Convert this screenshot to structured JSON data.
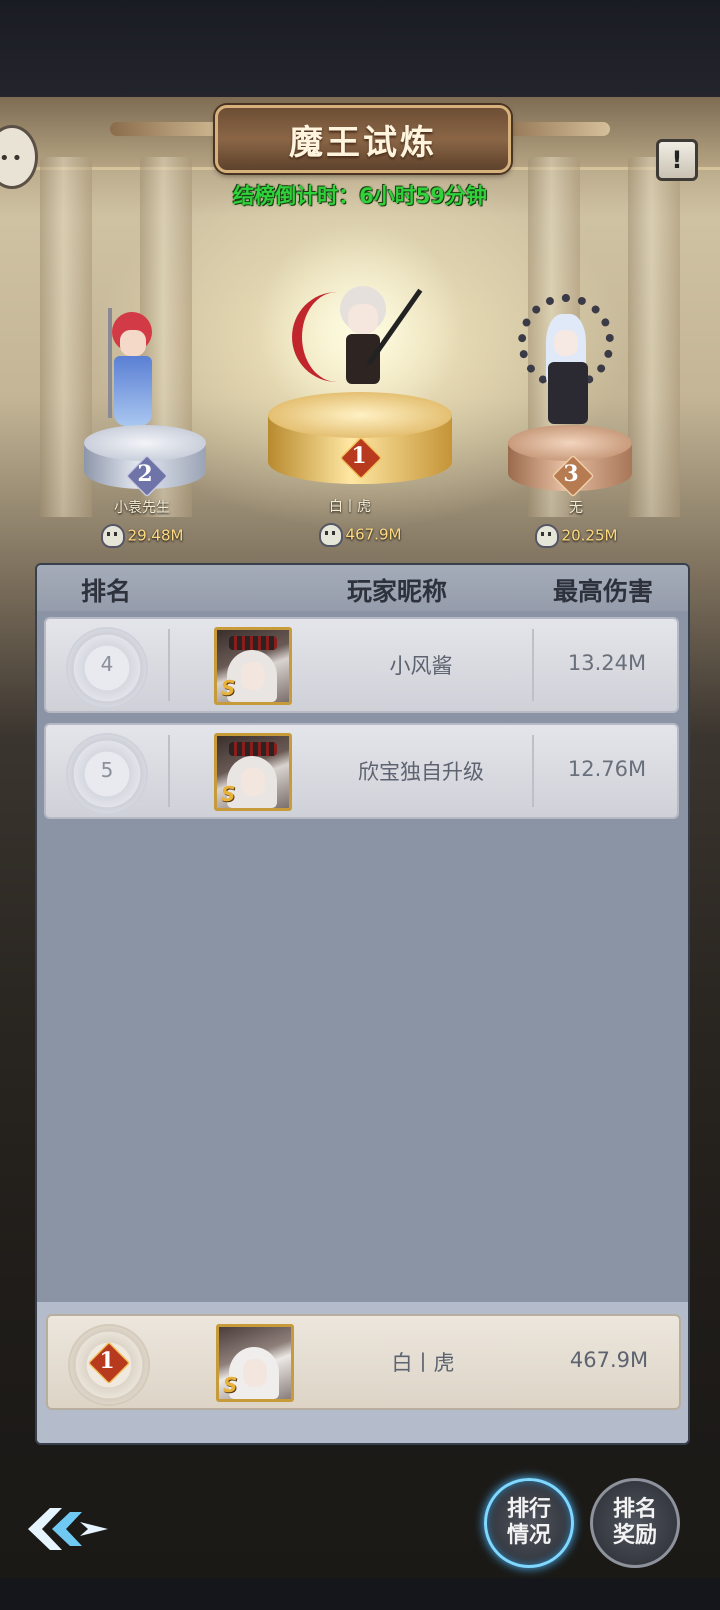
{
  "header": {
    "title": "魔王试炼",
    "countdown": "结榜倒计时：6小时59分钟",
    "info_icon": "exclamation-icon",
    "chat_icon": "chat-bubble-icon"
  },
  "podium": {
    "first": {
      "rank": "1",
      "name": "白丨虎",
      "damage": "467.9M"
    },
    "second": {
      "rank": "2",
      "name": "小袁先生",
      "damage": "29.48M"
    },
    "third": {
      "rank": "3",
      "name": "无",
      "damage": "20.25M"
    }
  },
  "table": {
    "headers": {
      "rank": "排名",
      "name": "玩家昵称",
      "damage": "最高伤害"
    },
    "rows": [
      {
        "rank": "4",
        "name": "小风酱",
        "damage": "13.24M"
      },
      {
        "rank": "5",
        "name": "欣宝独自升级",
        "damage": "12.76M"
      }
    ]
  },
  "my_rank": {
    "rank": "1",
    "name": "白丨虎",
    "damage": "467.9M"
  },
  "buttons": {
    "ranking_line1": "排行",
    "ranking_line2": "情况",
    "reward_line1": "排名",
    "reward_line2": "奖励"
  },
  "colors": {
    "countdown_green": "#2fd23b",
    "gold": "#c79a3a",
    "silver_badge": "#6f74a8",
    "bronze_badge": "#b77b52"
  }
}
